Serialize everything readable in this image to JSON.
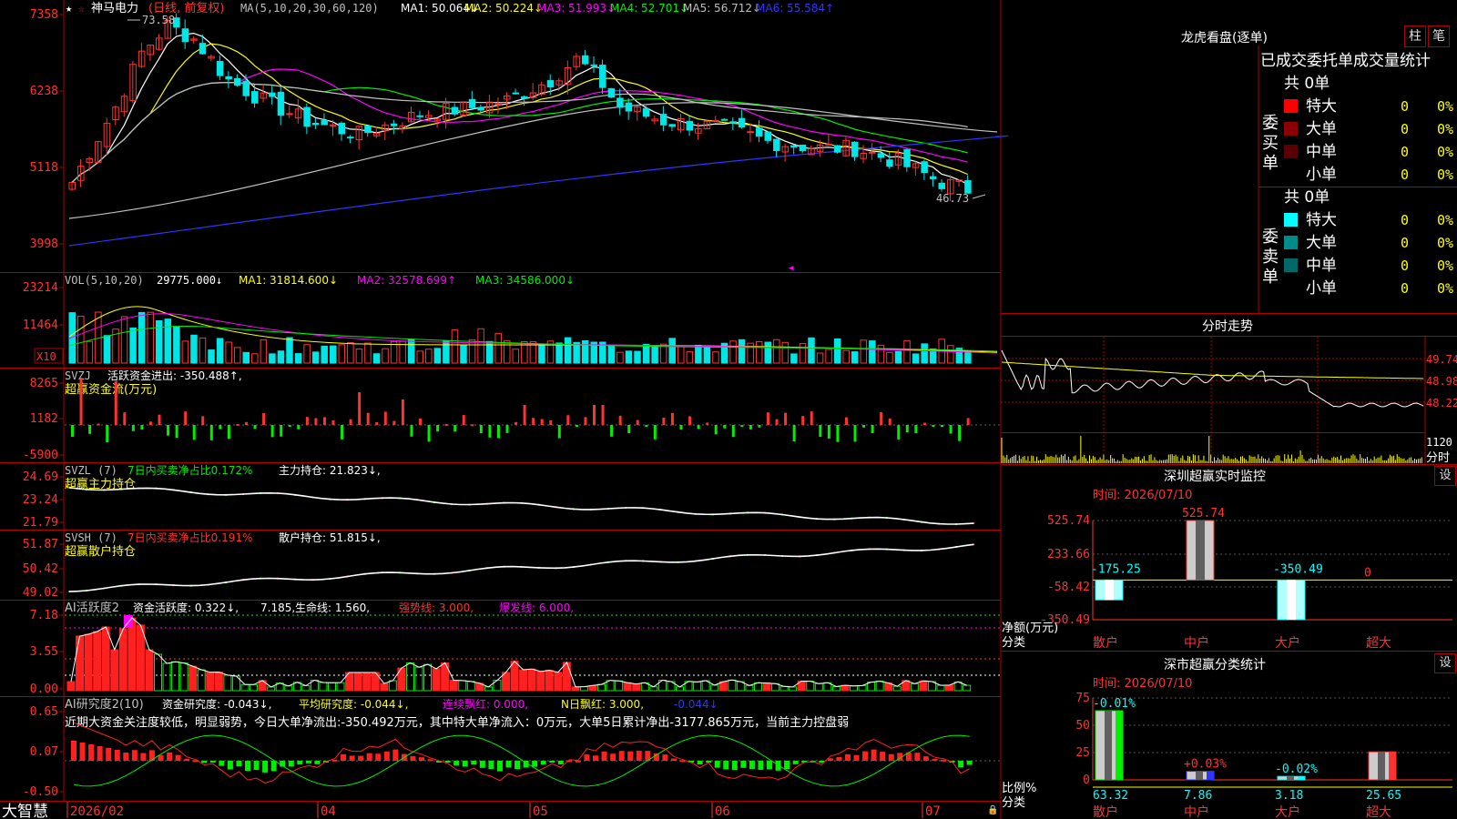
{
  "app": {
    "brand": "大智慧"
  },
  "colors": {
    "up": "#ff3232",
    "down": "#00e5e5",
    "green": "#00ee00",
    "grid": "#b00000",
    "white": "#ffffff",
    "yellow": "#ffff00",
    "magenta": "#ff00ff",
    "blue": "#3333ff",
    "gray": "#c0c0c0",
    "pink": "#ff80c0"
  },
  "kline": {
    "stock_name": "神马电力",
    "mode": "(日线, 前复权)",
    "ma_title": "MA(5,10,20,30,60,120)",
    "ma_values": [
      {
        "label": "MA1: 50.064↓",
        "color": "#ffffff"
      },
      {
        "label": "MA2: 50.224↓",
        "color": "#ffff00"
      },
      {
        "label": "MA3: 51.993↓",
        "color": "#ff00ff"
      },
      {
        "label": "MA4: 52.701↓",
        "color": "#00ee00"
      },
      {
        "label": "MA5: 56.712↓",
        "color": "#c0c0c0"
      },
      {
        "label": "MA6: 55.584↑",
        "color": "#3333ff"
      }
    ],
    "high_label": "73.58",
    "low_label": "46.73",
    "y_ticks": [
      "7358",
      "6238",
      "5118",
      "3998"
    ]
  },
  "vol": {
    "title": "VOL(5,10,20)",
    "value": "29775.000↓",
    "ma": [
      {
        "label": "MA1: 31814.600↓",
        "color": "#ffff00"
      },
      {
        "label": "MA2: 32578.699↑",
        "color": "#ff00ff"
      },
      {
        "label": "MA3: 34586.000↓",
        "color": "#00ee00"
      }
    ],
    "y_ticks": [
      "23214",
      "11464"
    ],
    "unit": "X10"
  },
  "svzj": {
    "title": "SVZJ",
    "line1": "活跃资金进出: -350.488↑,",
    "line2": "超赢资金流(万元)",
    "y_ticks": [
      "8265",
      "1182",
      "-5900"
    ]
  },
  "svzl": {
    "title": "SVZL (7)",
    "pct": "7日内买卖净占比0.172%",
    "hold": "主力持仓: 21.823↓,",
    "line2": "超赢主力持仓",
    "y_ticks": [
      "24.69",
      "23.24",
      "21.79"
    ]
  },
  "svsh": {
    "title": "SVSH (7)",
    "pct": "7日内买卖净占比0.191%",
    "hold": "散户持仓: 51.815↓,",
    "line2": "超赢散户持仓",
    "y_ticks": [
      "51.87",
      "50.42",
      "49.02"
    ]
  },
  "ai1": {
    "title": "AI活跃度2",
    "vals": [
      {
        "label": "资金活跃度: 0.322↓,",
        "color": "#ffffff"
      },
      {
        "label": "7.185,",
        "color": "#ffffff"
      },
      {
        "label": "生命线: 1.560,",
        "color": "#ffffff"
      },
      {
        "label": "强势线: 3.000,",
        "color": "#ff3232"
      },
      {
        "label": "爆发线: 6.000,",
        "color": "#ff00ff"
      }
    ],
    "y_ticks": [
      "7.18",
      "3.55",
      "0.00"
    ]
  },
  "ai2": {
    "title": "AI研究度2(10)",
    "vals": [
      {
        "label": "资金研究度: -0.043↓,",
        "color": "#ffffff"
      },
      {
        "label": "平均研究度: -0.044↓,",
        "color": "#ffff00"
      },
      {
        "label": "连续飘红: 0.000,",
        "color": "#ff00ff"
      },
      {
        "label": "N日飘红: 3.000,",
        "color": "#ffff00"
      },
      {
        "label": "-0.044↓",
        "color": "#3333ff"
      }
    ],
    "comment": "近期大资金关注度较低，明显弱势，今日大单净流出:-350.492万元，其中特大单净流入：0万元，大单5日累计净出-3177.865万元，当前主力控盘弱",
    "y_ticks": [
      "0.65",
      "0.07",
      "-0.50"
    ]
  },
  "xaxis": {
    "labels": [
      "2026/02",
      "04",
      "05",
      "06",
      "07"
    ]
  },
  "panel_dragon": {
    "title": "龙虎看盘(逐单)",
    "btn1": "柱",
    "btn2": "笔",
    "subtitle": "已成交委托单成交量统计",
    "buy_label": "委买单",
    "sell_label": "委卖单",
    "buy_total": "共 0单",
    "sell_total": "共 0单",
    "buy_rows": [
      {
        "name": "特大",
        "count": "0",
        "pct": "0%",
        "color": "#ff0000"
      },
      {
        "name": "大单",
        "count": "0",
        "pct": "0%",
        "color": "#8b0000"
      },
      {
        "name": "中单",
        "count": "0",
        "pct": "0%",
        "color": "#5a0000"
      },
      {
        "name": "小单",
        "count": "0",
        "pct": "0%",
        "color": ""
      }
    ],
    "sell_rows": [
      {
        "name": "特大",
        "count": "0",
        "pct": "0%",
        "color": "#00ffff"
      },
      {
        "name": "大单",
        "count": "0",
        "pct": "0%",
        "color": "#008b8b"
      },
      {
        "name": "中单",
        "count": "0",
        "pct": "0%",
        "color": "#006868"
      },
      {
        "name": "小单",
        "count": "0",
        "pct": "0%",
        "color": ""
      }
    ]
  },
  "panel_minute": {
    "title": "分时走势",
    "y_ticks": [
      "49.74",
      "48.98",
      "48.22"
    ],
    "vol_tick": "1120",
    "side_label": "分时"
  },
  "panel_sz": {
    "title": "深圳超赢实时监控",
    "btn": "设",
    "time": "时间: 2026/07/10",
    "y_ticks": [
      "525.74",
      "233.66",
      "-58.42",
      "-350.49"
    ],
    "y_label1": "净额(万元)",
    "y_label2": "分类",
    "bars": [
      {
        "cat": "散户",
        "value": -175.25,
        "label": "-175.25"
      },
      {
        "cat": "中户",
        "value": 525.74,
        "label": "525.74"
      },
      {
        "cat": "大户",
        "value": -350.49,
        "label": "-350.49"
      },
      {
        "cat": "超大",
        "value": 0,
        "label": "0"
      }
    ]
  },
  "panel_sh": {
    "title": "深市超赢分类统计",
    "btn": "设",
    "time": "时间: 2026/07/10",
    "y_ticks": [
      "75",
      "50",
      "25",
      "0"
    ],
    "y_label1": "比例%",
    "y_label2": "分类",
    "bars": [
      {
        "cat": "散户",
        "value": 63.32,
        "label": "63.32",
        "chg": "-0.01%"
      },
      {
        "cat": "中户",
        "value": 7.86,
        "label": "7.86",
        "chg": "+0.03%"
      },
      {
        "cat": "大户",
        "value": 3.18,
        "label": "3.18",
        "chg": "-0.02%"
      },
      {
        "cat": "超大",
        "value": 25.65,
        "label": "25.65",
        "chg": ""
      }
    ]
  }
}
